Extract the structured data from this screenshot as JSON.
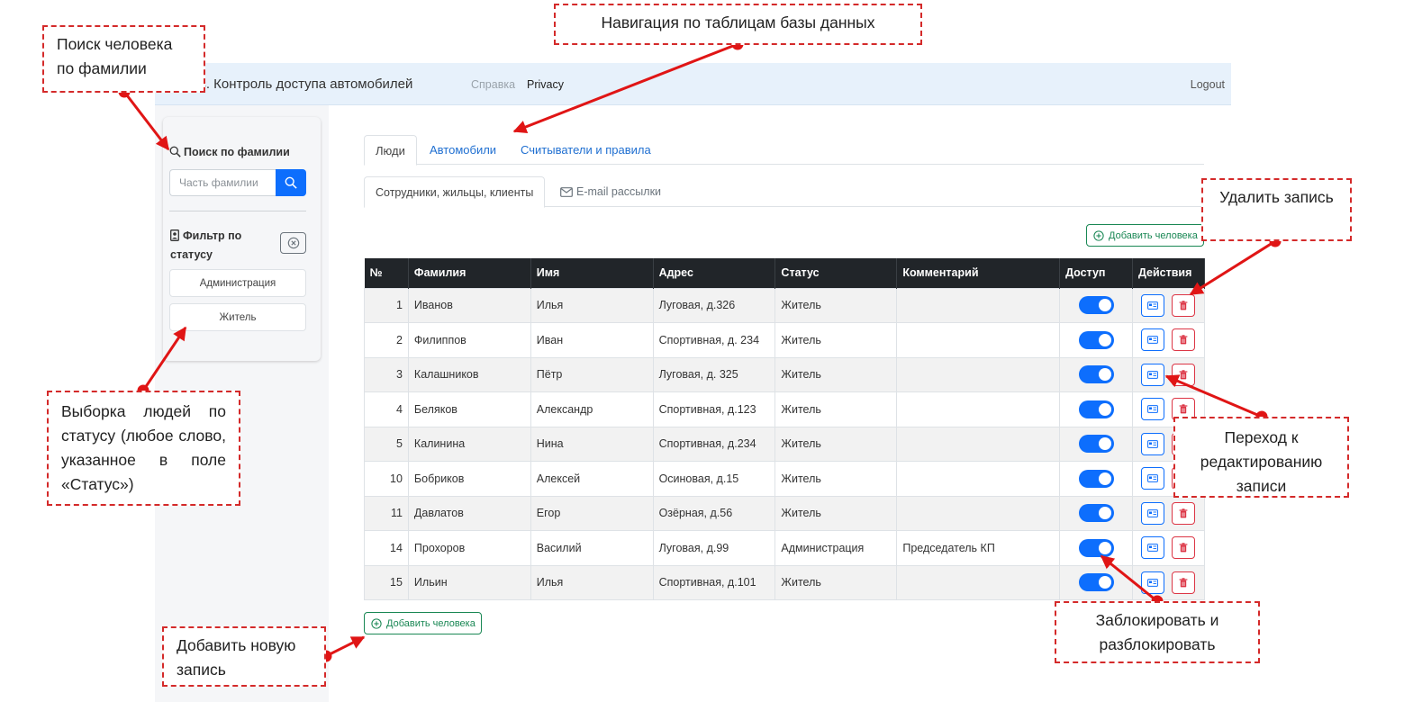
{
  "navbar": {
    "brand": "cess. Контроль доступа автомобилей",
    "links": [
      "Справка",
      "Privacy"
    ],
    "logout": "Logout"
  },
  "sidebar": {
    "search_title": "Поиск по фамилии",
    "search_placeholder": "Часть фамилии",
    "filter_title": "Фильтр по статусу",
    "statuses": [
      "Администрация",
      "Житель"
    ]
  },
  "tabs": [
    "Люди",
    "Автомобили",
    "Считыватели и правила"
  ],
  "subtabs": [
    "Сотрудники, жильцы, клиенты",
    "E-mail рассылки"
  ],
  "add_person": "Добавить человека",
  "table": {
    "headers": [
      "№",
      "Фамилия",
      "Имя",
      "Адрес",
      "Статус",
      "Комментарий",
      "Доступ",
      "Действия"
    ],
    "rows": [
      {
        "n": "1",
        "last": "Иванов",
        "first": "Илья",
        "addr": "Луговая, д.326",
        "status": "Житель",
        "comment": ""
      },
      {
        "n": "2",
        "last": "Филиппов",
        "first": "Иван",
        "addr": "Спортивная, д. 234",
        "status": "Житель",
        "comment": ""
      },
      {
        "n": "3",
        "last": "Калашников",
        "first": "Пётр",
        "addr": "Луговая, д. 325",
        "status": "Житель",
        "comment": ""
      },
      {
        "n": "4",
        "last": "Беляков",
        "first": "Александр",
        "addr": "Спортивная, д.123",
        "status": "Житель",
        "comment": ""
      },
      {
        "n": "5",
        "last": "Калинина",
        "first": "Нина",
        "addr": "Спортивная, д.234",
        "status": "Житель",
        "comment": ""
      },
      {
        "n": "10",
        "last": "Бобриков",
        "first": "Алексей",
        "addr": "Осиновая, д.15",
        "status": "Житель",
        "comment": ""
      },
      {
        "n": "11",
        "last": "Давлатов",
        "first": "Егор",
        "addr": "Озёрная, д.56",
        "status": "Житель",
        "comment": ""
      },
      {
        "n": "14",
        "last": "Прохоров",
        "first": "Василий",
        "addr": "Луговая, д.99",
        "status": "Администрация",
        "comment": "Председатель КП"
      },
      {
        "n": "15",
        "last": "Ильин",
        "first": "Илья",
        "addr": "Спортивная, д.101",
        "status": "Житель",
        "comment": ""
      }
    ]
  },
  "annotations": {
    "search": "Поиск человека по фамилии",
    "nav": "Навигация по таблицам базы данных",
    "delete": "Удалить запись",
    "filter": "Выборка людей по статусу (любое слово, указанное в поле «Статус»)",
    "edit": "Переход к редактированию записи",
    "block": "Заблокировать и разблокировать",
    "add": "Добавить новую запись"
  },
  "colors": {
    "primary": "#0d6efd",
    "success": "#198754",
    "danger": "#dc3545",
    "annotation": "#d42a2a",
    "navbar_bg": "#e7f1fb"
  }
}
